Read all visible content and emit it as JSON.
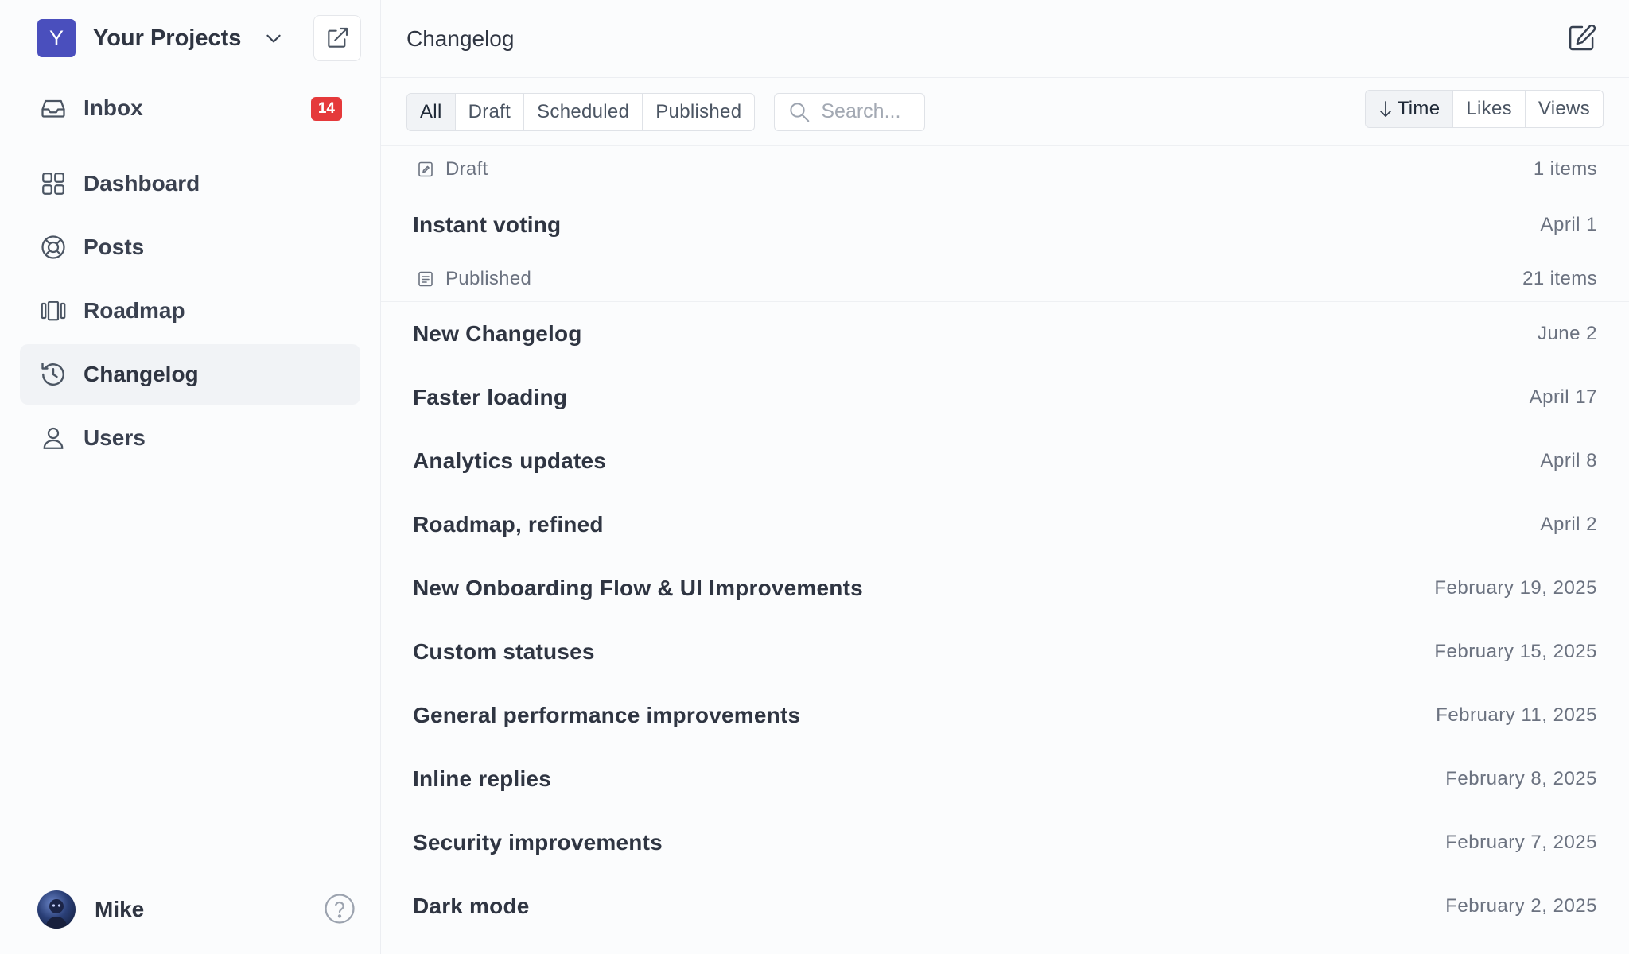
{
  "sidebar": {
    "project": {
      "initial": "Y",
      "name": "Your Projects"
    },
    "nav": [
      {
        "label": "Inbox",
        "badge": "14"
      },
      {
        "label": "Dashboard"
      },
      {
        "label": "Posts"
      },
      {
        "label": "Roadmap"
      },
      {
        "label": "Changelog"
      },
      {
        "label": "Users"
      }
    ],
    "user": {
      "name": "Mike"
    }
  },
  "header": {
    "title": "Changelog"
  },
  "filters": {
    "tabs": [
      "All",
      "Draft",
      "Scheduled",
      "Published"
    ],
    "active_tab": "All",
    "search_placeholder": "Search..."
  },
  "sort": {
    "options": [
      "Time",
      "Likes",
      "Views"
    ],
    "active": "Time"
  },
  "groups": [
    {
      "label": "Draft",
      "count": "1 items",
      "posts": [
        {
          "title": "Instant voting",
          "date": "April 1"
        }
      ]
    },
    {
      "label": "Published",
      "count": "21 items",
      "posts": [
        {
          "title": "New Changelog",
          "date": "June 2"
        },
        {
          "title": "Faster loading",
          "date": "April 17"
        },
        {
          "title": "Analytics updates",
          "date": "April 8"
        },
        {
          "title": "Roadmap, refined",
          "date": "April 2"
        },
        {
          "title": "New Onboarding Flow & UI Improvements",
          "date": "February 19, 2025"
        },
        {
          "title": "Custom statuses",
          "date": "February 15, 2025"
        },
        {
          "title": "General performance improvements",
          "date": "February 11, 2025"
        },
        {
          "title": "Inline replies",
          "date": "February 8, 2025"
        },
        {
          "title": "Security improvements",
          "date": "February 7, 2025"
        },
        {
          "title": "Dark mode",
          "date": "February 2, 2025"
        }
      ]
    }
  ],
  "colors": {
    "accent": "#4a4fbd",
    "badge": "#e5393b",
    "active_bg": "#f1f3f6"
  }
}
